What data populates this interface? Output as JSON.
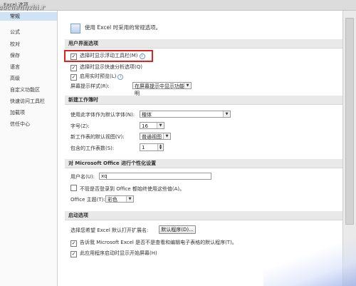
{
  "window": {
    "title": "Excel 选项",
    "watermark": "aochengzhi.r"
  },
  "sidebar": {
    "items": [
      {
        "label": "常规",
        "active": true
      },
      {
        "label": "公式"
      },
      {
        "label": "校对"
      },
      {
        "label": "保存"
      },
      {
        "label": "语言"
      },
      {
        "label": "高级"
      },
      {
        "label": "自定义功能区"
      },
      {
        "label": "快速访问工具栏"
      },
      {
        "label": "加载项"
      },
      {
        "label": "信任中心"
      }
    ]
  },
  "header": {
    "text": "使用 Excel 时采用的常规选项。"
  },
  "ui_options": {
    "title": "用户界面选项",
    "mini_toolbar": {
      "label": "选择时显示浮动工具栏(M)",
      "checked": true
    },
    "quick_analysis": {
      "label": "选择时显示快速分析选项(Q)",
      "checked": true
    },
    "live_preview": {
      "label": "启用实时预览(L)",
      "checked": true
    },
    "screentip": {
      "label": "屏幕提示样式(R):",
      "value": "在屏幕提示中显示功能说明"
    }
  },
  "new_workbook": {
    "title": "新建工作簿时",
    "font": {
      "label": "使用此字体作为默认字体(N):",
      "value": "楷体"
    },
    "size": {
      "label": "字号(Z):",
      "value": "16"
    },
    "view": {
      "label": "新工作表的默认视图(V):",
      "value": "普通视图"
    },
    "sheets": {
      "label": "包含的工作表数(S):",
      "value": "1"
    }
  },
  "personalize": {
    "title": "对 Microsoft Office 进行个性化设置",
    "username": {
      "label": "用户名(U):",
      "value": "xq"
    },
    "always_use": {
      "label": "不管是否登录到 Office 都始终使用这些值(A)。",
      "checked": false
    },
    "theme": {
      "label": "Office 主题(T):",
      "value": "彩色"
    }
  },
  "startup": {
    "title": "启动选项",
    "extensions": {
      "label": "选择您希望 Excel 默认打开扩展名:",
      "button": "默认程序(D)..."
    },
    "tell_me": {
      "label": "告诉我 Microsoft Excel 是否不是查看和编辑电子表格的默认程序(T)。",
      "checked": true
    },
    "start_screen": {
      "label": "此应用程序启动时显示开始屏幕(H)",
      "checked": true
    }
  },
  "icons": {
    "check": "✓",
    "info": "i",
    "dropdown": "▼",
    "spin_up": "▲",
    "spin_down": "▼"
  }
}
